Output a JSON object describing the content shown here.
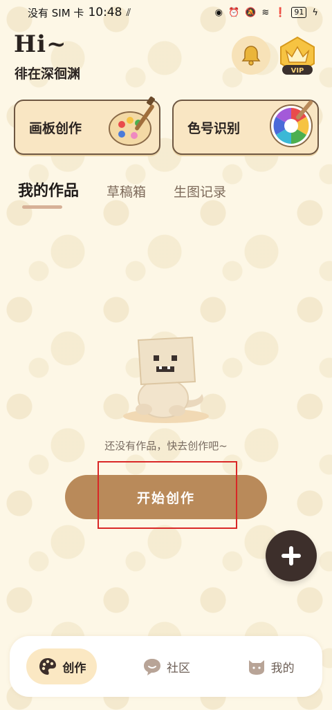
{
  "status_bar": {
    "carrier": "没有 SIM 卡",
    "time": "10:48",
    "battery": "91"
  },
  "header": {
    "greeting": "Hi~",
    "username": "徘在深徊渊",
    "vip_label": "VIP"
  },
  "cards": [
    {
      "label": "画板创作",
      "icon": "palette-icon"
    },
    {
      "label": "色号识别",
      "icon": "color-wheel-icon"
    }
  ],
  "tabs": [
    {
      "label": "我的作品",
      "active": true
    },
    {
      "label": "草稿箱",
      "active": false
    },
    {
      "label": "生图记录",
      "active": false
    }
  ],
  "empty_state": {
    "message": "还没有作品，快去创作吧~",
    "button_label": "开始创作"
  },
  "bottom_nav": [
    {
      "label": "创作",
      "icon": "palette-icon",
      "active": true
    },
    {
      "label": "社区",
      "icon": "chat-bubble-icon",
      "active": false
    },
    {
      "label": "我的",
      "icon": "cat-face-icon",
      "active": false
    }
  ],
  "colors": {
    "background": "#fdf7e6",
    "accent_button": "#b98a5a",
    "fab": "#3d2f2b",
    "card_fill": "#f9e6c3",
    "highlight_box": "#d92626"
  }
}
